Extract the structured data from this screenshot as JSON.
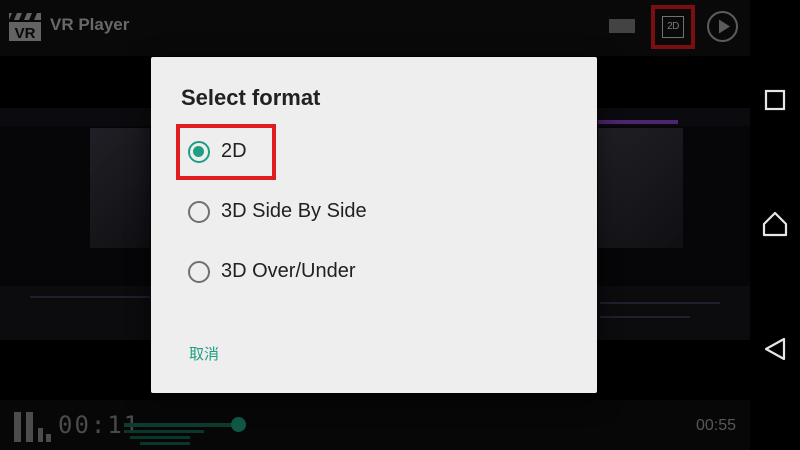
{
  "toolbar": {
    "logo_text": "VR",
    "title": "VR Player",
    "mode_button_label": "2D"
  },
  "player": {
    "current_time": "00:11",
    "total_time": "00:55",
    "progress": 0.2
  },
  "dialog": {
    "title": "Select format",
    "options": [
      {
        "label": "2D",
        "selected": true
      },
      {
        "label": "3D Side By Side",
        "selected": false
      },
      {
        "label": "3D Over/Under",
        "selected": false
      }
    ],
    "cancel_label": "取消"
  },
  "colors": {
    "accent": "#1f9e83",
    "highlight_border": "#e01d1d"
  },
  "icons": {
    "nav": [
      "square-recents-icon",
      "home-icon",
      "back-triangle-icon"
    ],
    "toolbar": [
      "vr-clapper-logo-icon",
      "screen-rect-icon",
      "play-circle-icon"
    ]
  }
}
